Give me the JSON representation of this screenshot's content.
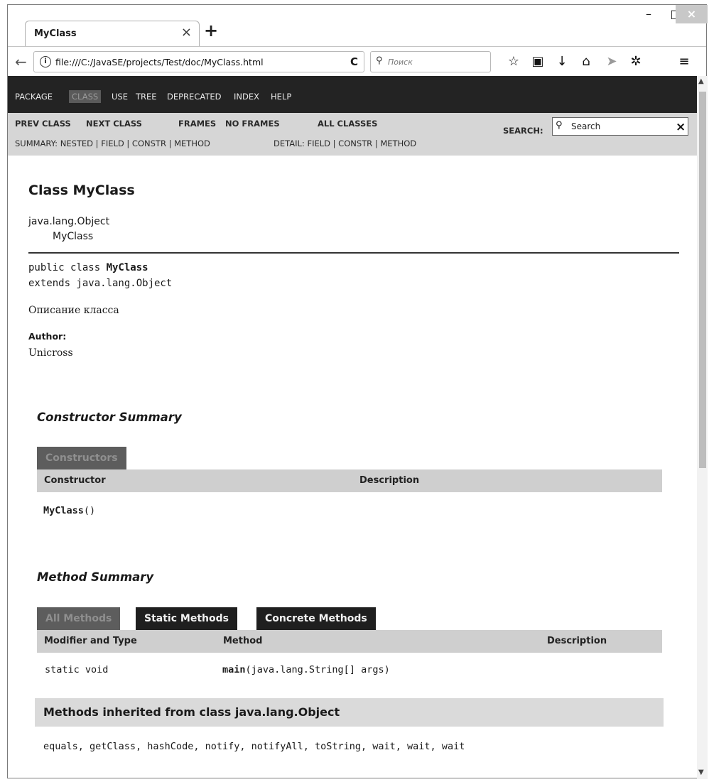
{
  "browser": {
    "tab_title": "MyClass",
    "tab_close": "×",
    "new_tab": "+",
    "url": "file:///C:/JavaSE/projects/Test/doc/MyClass.html",
    "search_placeholder": "Поиск",
    "window_min": "–",
    "window_max": "□",
    "window_close": "×"
  },
  "topnav": {
    "items": [
      "PACKAGE",
      "CLASS",
      "USE",
      "TREE",
      "DEPRECATED",
      "INDEX",
      "HELP"
    ]
  },
  "subnav": {
    "prev_class": "PREV CLASS",
    "next_class": "NEXT CLASS",
    "frames": "FRAMES",
    "no_frames": "NO FRAMES",
    "all_classes": "ALL CLASSES",
    "summary": "SUMMARY: NESTED | FIELD | CONSTR | METHOD",
    "detail": "DETAIL: FIELD | CONSTR | METHOD",
    "search_label": "SEARCH:",
    "search_value": "Search",
    "search_clear": "×"
  },
  "class_page": {
    "title": "Class MyClass",
    "inheritance": [
      "java.lang.Object",
      "MyClass"
    ],
    "decl_prefix": "public class ",
    "decl_name": "MyClass",
    "decl_extends": "extends java.lang.Object",
    "description": "Описание класса",
    "author_label": "Author:",
    "author": "Unicross"
  },
  "constructor_summary": {
    "heading": "Constructor Summary",
    "caption": "Constructors",
    "columns": [
      "Constructor",
      "Description"
    ],
    "rows": [
      {
        "constructor": "MyClass()"
      }
    ],
    "row_name": "MyClass",
    "row_args": "()"
  },
  "method_summary": {
    "heading": "Method Summary",
    "tabs": [
      "All Methods",
      "Static Methods",
      "Concrete Methods"
    ],
    "columns": [
      "Modifier and Type",
      "Method",
      "Description"
    ],
    "rows": [
      {
        "modifier": "static void",
        "method_name": "main",
        "method_args": "(java.lang.String[] args)"
      }
    ]
  },
  "inherited": {
    "title": "Methods inherited from class java.lang.Object",
    "methods": "equals, getClass, hashCode, notify, notifyAll, toString, wait, wait, wait"
  }
}
